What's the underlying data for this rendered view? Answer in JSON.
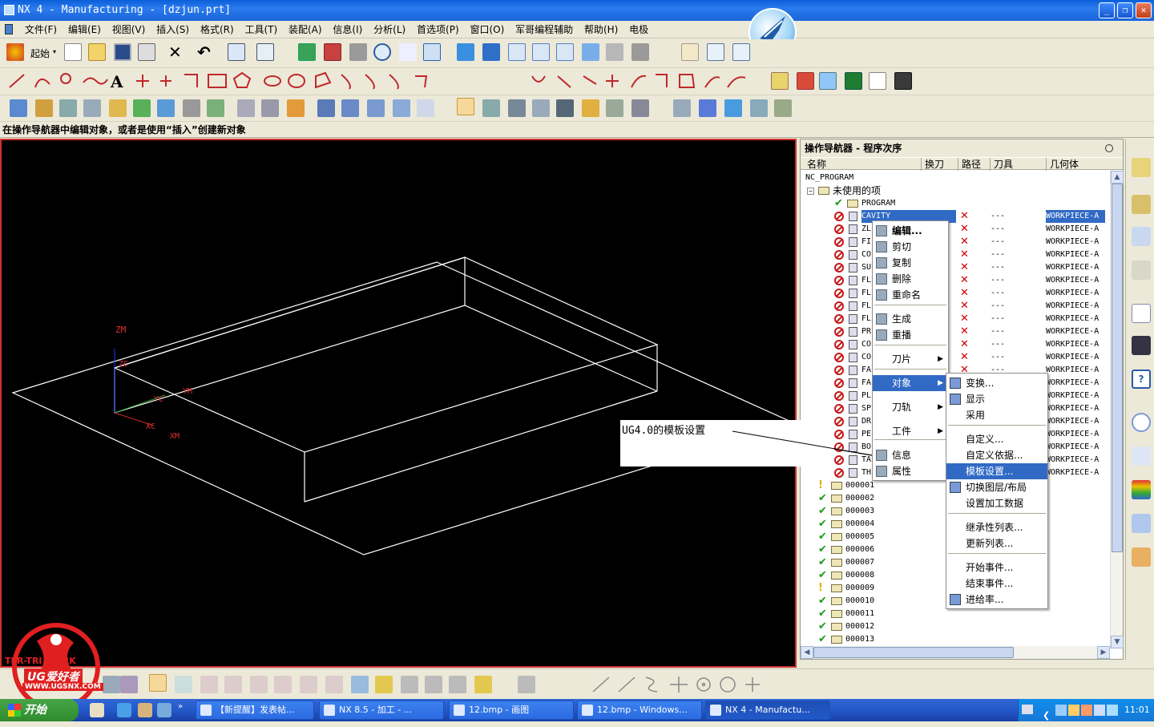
{
  "window": {
    "title": "NX 4 - Manufacturing - [dzjun.prt]"
  },
  "menu": [
    "文件(F)",
    "编辑(E)",
    "视图(V)",
    "插入(S)",
    "格式(R)",
    "工具(T)",
    "装配(A)",
    "信息(I)",
    "分析(L)",
    "首选项(P)",
    "窗口(O)",
    "军哥编程辅助",
    "帮助(H)",
    "电极"
  ],
  "toolbar": {
    "start_label": "起始"
  },
  "status": {
    "message": "在操作导航器中编辑对象，或者是使用“插入”创建新对象"
  },
  "viewport": {
    "axis_labels": [
      "ZM",
      "ZC",
      "YC",
      "YM",
      "XC",
      "XM"
    ]
  },
  "navigator": {
    "title": "操作导航器 - 程序次序",
    "columns": [
      "名称",
      "换刀",
      "路径",
      "刀具",
      "几何体"
    ],
    "root": "NC_PROGRAM",
    "unused": "未使用的项",
    "program": "PROGRAM",
    "selected": {
      "name": "CAVITY",
      "tool": "---",
      "geo": "WORKPIECE-A"
    },
    "ops": [
      {
        "name": "ZL"
      },
      {
        "name": "FI"
      },
      {
        "name": "CO"
      },
      {
        "name": "SU"
      },
      {
        "name": "FL"
      },
      {
        "name": "FL"
      },
      {
        "name": "FL"
      },
      {
        "name": "FL"
      },
      {
        "name": "PR"
      },
      {
        "name": "CO"
      },
      {
        "name": "CO"
      },
      {
        "name": "FA"
      },
      {
        "name": "FA"
      },
      {
        "name": "PL"
      },
      {
        "name": "SP"
      },
      {
        "name": "DR"
      },
      {
        "name": "PE"
      },
      {
        "name": "BO"
      },
      {
        "name": "TA"
      },
      {
        "name": "TH"
      }
    ],
    "op_tool": "---",
    "op_geo": "WORKPIECE-A",
    "groups": [
      {
        "name": "000001",
        "status": "warn"
      },
      {
        "name": "000002",
        "status": "ok"
      },
      {
        "name": "000003",
        "status": "ok"
      },
      {
        "name": "000004",
        "status": "ok"
      },
      {
        "name": "000005",
        "status": "ok"
      },
      {
        "name": "000006",
        "status": "ok"
      },
      {
        "name": "000007",
        "status": "ok"
      },
      {
        "name": "000008",
        "status": "ok"
      },
      {
        "name": "000009",
        "status": "warn"
      },
      {
        "name": "000010",
        "status": "ok"
      },
      {
        "name": "000011",
        "status": "ok"
      },
      {
        "name": "000012",
        "status": "ok"
      },
      {
        "name": "000013",
        "status": "ok"
      }
    ]
  },
  "context_menu": {
    "items": [
      "编辑...",
      "剪切",
      "复制",
      "删除",
      "重命名",
      "生成",
      "重播",
      "刀片",
      "对象",
      "刀轨",
      "工件",
      "信息",
      "属性"
    ]
  },
  "submenu": {
    "items": [
      "变换...",
      "显示",
      "采用",
      "自定义...",
      "自定义依据...",
      "模板设置...",
      "切换图层/布局",
      "设置加工数据",
      "继承性列表...",
      "更新列表...",
      "开始事件...",
      "结束事件...",
      "进给率..."
    ]
  },
  "annotation": {
    "text": "UG4.0的模板设置"
  },
  "taskbar": {
    "start": "开始",
    "tasks": [
      "【新提醒】发表帖...",
      "NX 8.5 - 加工 - ...",
      "12.bmp - 画图",
      "12.bmp - Windows...",
      "NX 4 - Manufactu..."
    ],
    "clock": "11:01"
  },
  "watermark": {
    "line1": "UG爱好者",
    "line2": "WWW.UGSNX.COM",
    "line3": "TER-TRI WORK"
  }
}
